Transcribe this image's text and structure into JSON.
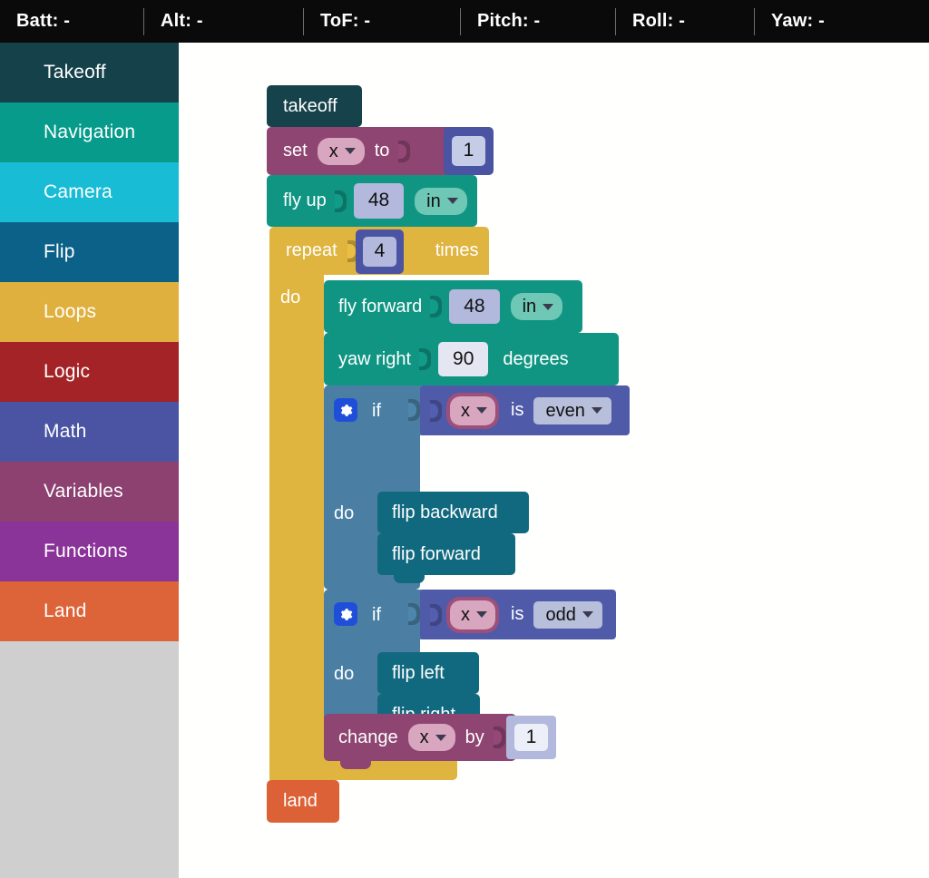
{
  "telemetry": {
    "items": [
      {
        "label": "Batt: -"
      },
      {
        "label": "Alt: -"
      },
      {
        "label": "ToF: -"
      },
      {
        "label": "Pitch: -"
      },
      {
        "label": "Roll: -"
      },
      {
        "label": "Yaw: -"
      }
    ]
  },
  "toolbox": {
    "categories": [
      {
        "label": "Takeoff",
        "color": "#15414b"
      },
      {
        "label": "Navigation",
        "color": "#069b8a"
      },
      {
        "label": "Camera",
        "color": "#18bcd4"
      },
      {
        "label": "Flip",
        "color": "#0b6188"
      },
      {
        "label": "Loops",
        "color": "#e0b03f"
      },
      {
        "label": "Logic",
        "color": "#a32327"
      },
      {
        "label": "Math",
        "color": "#4a54a3"
      },
      {
        "label": "Variables",
        "color": "#8c4170"
      },
      {
        "label": "Functions",
        "color": "#8a3399"
      },
      {
        "label": "Land",
        "color": "#dd6438"
      }
    ],
    "empty_area_color": "#cfcfcf"
  },
  "colors": {
    "takeoff": "#16424c",
    "navigation": "#109583",
    "flip": "#11697f",
    "loops": "#dfb540",
    "logic": "#4f5aa8",
    "logic_if": "#4a7fa3",
    "variables": "#8e4571",
    "land": "#dd6136",
    "math": "#4a54a3",
    "math_light": "#b2b9dd",
    "field": "#c5cce8",
    "field_white": "#eceff7",
    "gear_blue": "#1f4fd8"
  },
  "program": {
    "takeoff": {
      "label": "takeoff"
    },
    "set_var": {
      "label": "set",
      "variable": "x",
      "to_label": "to",
      "value": "1"
    },
    "fly_up": {
      "label": "fly up",
      "value": "48",
      "unit": "in"
    },
    "repeat": {
      "label": "repeat",
      "times": "4",
      "times_label": "times",
      "do_label": "do"
    },
    "fly_forward": {
      "label": "fly forward",
      "value": "48",
      "unit": "in"
    },
    "yaw_right": {
      "label": "yaw right",
      "value": "90",
      "unit_label": "degrees"
    },
    "if_even": {
      "if_label": "if",
      "do_label": "do",
      "variable": "x",
      "is_label": "is",
      "test": "even",
      "body": [
        {
          "label": "flip backward"
        },
        {
          "label": "flip forward"
        }
      ]
    },
    "if_odd": {
      "if_label": "if",
      "do_label": "do",
      "variable": "x",
      "is_label": "is",
      "test": "odd",
      "body": [
        {
          "label": "flip left"
        },
        {
          "label": "flip right"
        }
      ]
    },
    "change_var": {
      "label": "change",
      "variable": "x",
      "by_label": "by",
      "value": "1"
    },
    "land": {
      "label": "land"
    }
  }
}
